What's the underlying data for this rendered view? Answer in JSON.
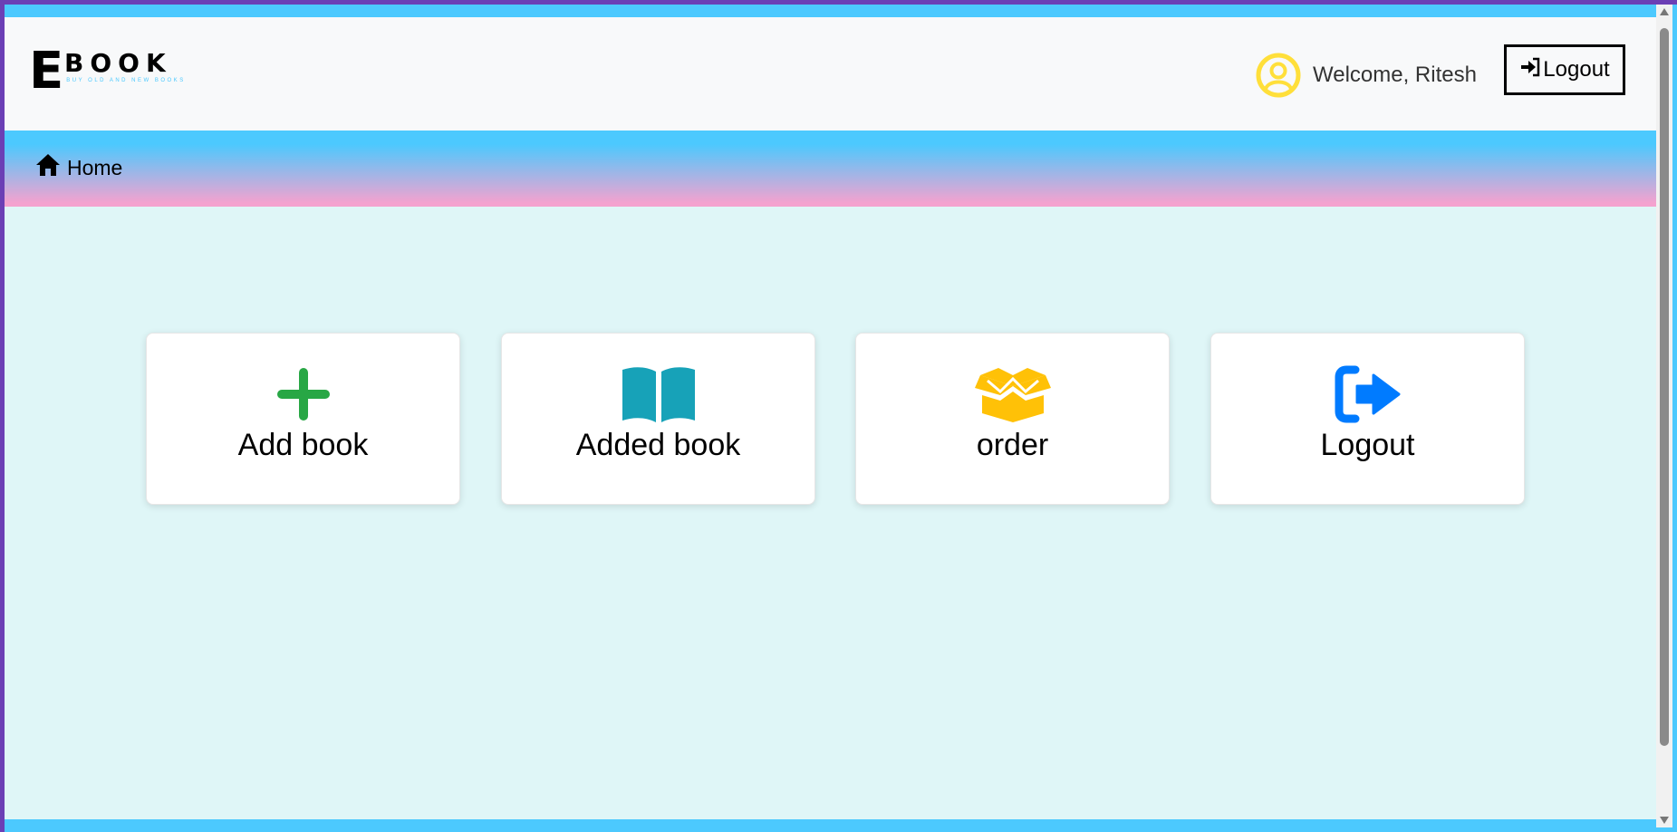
{
  "header": {
    "logo_letter": "E",
    "logo_word": "BOOK",
    "logo_tagline": "BUY OLD AND NEW BOOKS",
    "welcome_text": "Welcome, Ritesh",
    "logout_label": "Logout"
  },
  "nav": {
    "home_label": "Home"
  },
  "cards": [
    {
      "label": "Add book",
      "icon": "plus-icon",
      "color": "#28a745"
    },
    {
      "label": "Added book",
      "icon": "open-book-icon",
      "color": "#17a2b8"
    },
    {
      "label": "order",
      "icon": "box-open-icon",
      "color": "#ffc107"
    },
    {
      "label": "Logout",
      "icon": "sign-out-icon",
      "color": "#007bff"
    }
  ],
  "colors": {
    "accent_blue": "#4cc9fe",
    "accent_pink": "#f4a2cf",
    "avatar_yellow": "#ffdf3a",
    "page_background": "#dff6f7"
  }
}
